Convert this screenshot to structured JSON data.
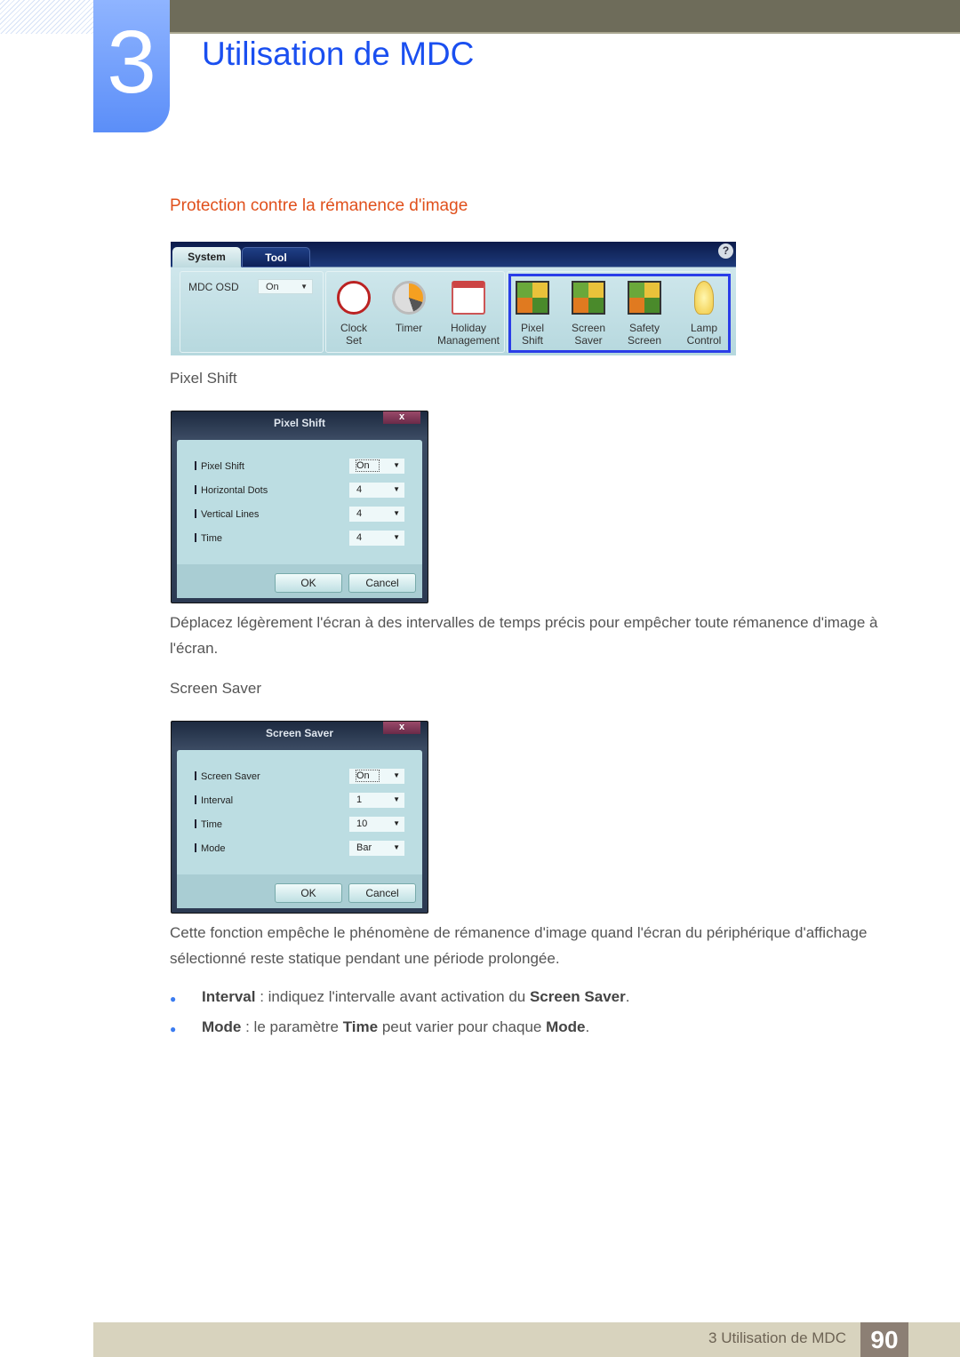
{
  "header": {
    "chapter_number": "3",
    "title": "Utilisation de MDC"
  },
  "section_title": "Protection contre la rémanence d'image",
  "toolbar": {
    "tabs": [
      "System",
      "Tool"
    ],
    "help": "?",
    "osd_label": "MDC OSD",
    "osd_value": "On",
    "tools": [
      {
        "l1": "Clock",
        "l2": "Set",
        "icon": "clock-icon"
      },
      {
        "l1": "Timer",
        "l2": "",
        "icon": "timer-icon"
      },
      {
        "l1": "Holiday",
        "l2": "Management",
        "icon": "calendar-icon"
      },
      {
        "l1": "Pixel",
        "l2": "Shift",
        "icon": "pixel-shift-icon"
      },
      {
        "l1": "Screen",
        "l2": "Saver",
        "icon": "screen-saver-icon"
      },
      {
        "l1": "Safety",
        "l2": "Screen",
        "icon": "safety-screen-icon"
      },
      {
        "l1": "Lamp",
        "l2": "Control",
        "icon": "lamp-icon"
      }
    ],
    "highlight_color": "#2a3de8"
  },
  "pixel_shift": {
    "heading": "Pixel Shift",
    "dialog_title": "Pixel Shift",
    "close": "x",
    "rows": [
      {
        "label": "Pixel Shift",
        "value": "On"
      },
      {
        "label": "Horizontal Dots",
        "value": "4"
      },
      {
        "label": "Vertical Lines",
        "value": "4"
      },
      {
        "label": "Time",
        "value": "4"
      }
    ],
    "ok": "OK",
    "cancel": "Cancel",
    "description": "Déplacez légèrement l'écran à des intervalles de temps précis pour empêcher toute rémanence d'image à l'écran."
  },
  "screen_saver": {
    "heading": "Screen Saver",
    "dialog_title": "Screen Saver",
    "close": "x",
    "rows": [
      {
        "label": "Screen Saver",
        "value": "On"
      },
      {
        "label": "Interval",
        "value": "1"
      },
      {
        "label": "Time",
        "value": "10"
      },
      {
        "label": "Mode",
        "value": "Bar"
      }
    ],
    "ok": "OK",
    "cancel": "Cancel",
    "description": "Cette fonction empêche le phénomène de rémanence d'image quand l'écran du périphérique d'affichage sélectionné reste statique pendant une période prolongée.",
    "bullets": [
      {
        "term": "Interval",
        "text": " : indiquez l'intervalle avant activation du ",
        "term2": "Screen Saver",
        "end": "."
      },
      {
        "term": "Mode",
        "text": " : le paramètre ",
        "term2": "Time",
        "mid": " peut varier pour chaque ",
        "term3": "Mode",
        "end": "."
      }
    ]
  },
  "footer": {
    "text": "3 Utilisation de MDC",
    "page": "90"
  }
}
